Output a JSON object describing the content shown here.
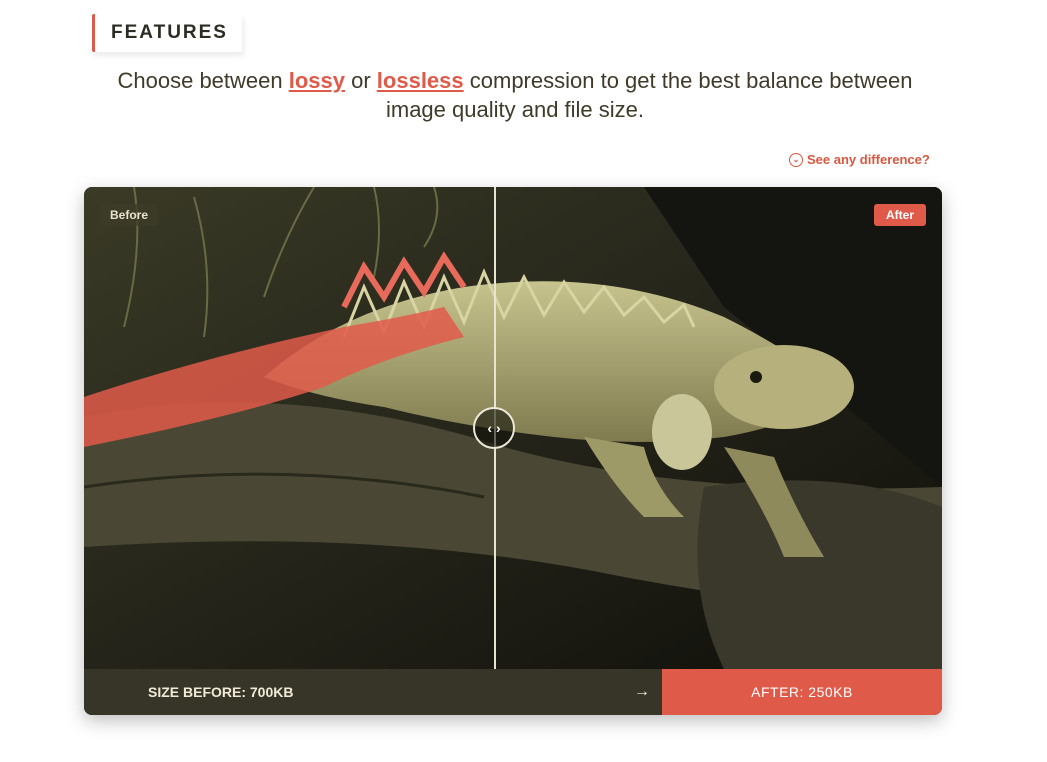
{
  "section": {
    "tag": "FEATURES"
  },
  "intro": {
    "prefix": "Choose between ",
    "lossy": "lossy",
    "middle": " or ",
    "lossless": "lossless",
    "suffix_line1": " compression to get the best balance between",
    "line2": "image quality and file size."
  },
  "difference_link": {
    "label": "See any difference?",
    "icon": "chevron-down-circle-icon"
  },
  "comparison": {
    "before_badge": "Before",
    "after_badge": "After",
    "size_before": "SIZE BEFORE: 700KB",
    "size_after": "AFTER: 250KB",
    "slider_icon": "left-right-chevrons-icon",
    "arrow_icon": "arrow-right-icon"
  },
  "colors": {
    "accent": "#e05a4a",
    "dark_bar": "#373527"
  }
}
